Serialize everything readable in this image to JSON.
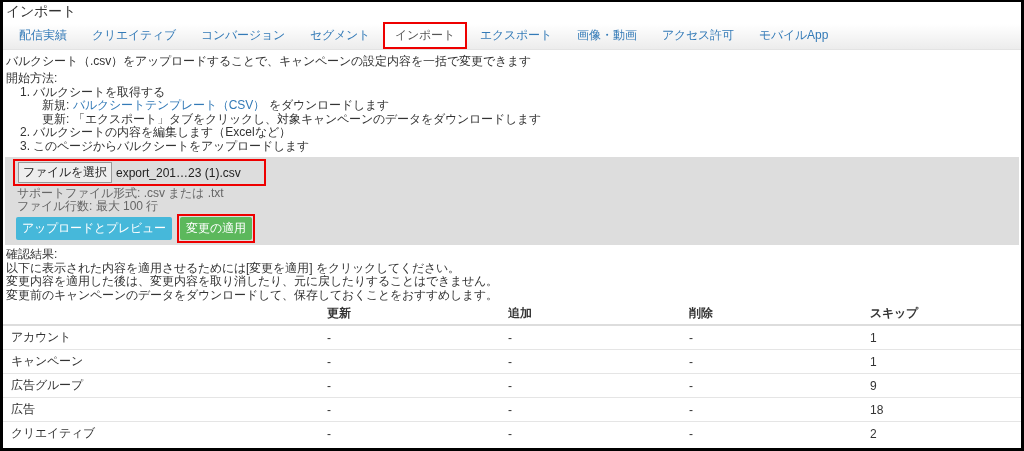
{
  "page_title": "インポート",
  "tabs": [
    {
      "label": "配信実績",
      "selected": false,
      "highlighted": false
    },
    {
      "label": "クリエイティブ",
      "selected": false,
      "highlighted": false
    },
    {
      "label": "コンバージョン",
      "selected": false,
      "highlighted": false
    },
    {
      "label": "セグメント",
      "selected": false,
      "highlighted": false
    },
    {
      "label": "インポート",
      "selected": true,
      "highlighted": true
    },
    {
      "label": "エクスポート",
      "selected": false,
      "highlighted": false
    },
    {
      "label": "画像・動画",
      "selected": false,
      "highlighted": false
    },
    {
      "label": "アクセス許可",
      "selected": false,
      "highlighted": false
    },
    {
      "label": "モバイルApp",
      "selected": false,
      "highlighted": false
    }
  ],
  "description": "バルクシート（.csv）をアップロードすることで、キャンペーンの設定内容を一括で変更できます",
  "instructions": {
    "heading": "開始方法:",
    "steps": [
      {
        "number": "1.",
        "text": "バルクシートを取得する",
        "children": [
          {
            "prefix": "新規: ",
            "link": "バルクシートテンプレート（CSV）",
            "suffix": " をダウンロードします"
          },
          {
            "prefix": "更新: 「エクスポート」タブをクリックし、対象キャンペーンのデータをダウンロードします"
          }
        ]
      },
      {
        "number": "2.",
        "text": "バルクシートの内容を編集します（Excelなど）"
      },
      {
        "number": "3.",
        "text": "このページからバルクシートをアップロードします"
      }
    ]
  },
  "upload": {
    "file_button": "ファイルを選択",
    "file_name": "export_201…23 (1).csv",
    "highlighted": true,
    "notes": [
      "サポートファイル形式: .csv または .txt",
      "ファイル行数: 最大 100 行"
    ],
    "buttons": [
      {
        "label": "アップロードとプレビュー",
        "kind": "info",
        "highlighted": false
      },
      {
        "label": "変更の適用",
        "kind": "success",
        "highlighted": true
      }
    ]
  },
  "results": {
    "heading": "確認結果:",
    "lines": [
      "以下に表示された内容を適用させるためには[変更を適用] をクリックしてください。",
      "変更内容を適用した後は、変更内容を取り消したり、元に戻したりすることはできません。",
      "変更前のキャンペーンのデータをダウンロードして、保存しておくことをおすすめします。"
    ]
  },
  "table": {
    "columns": [
      "",
      "更新",
      "追加",
      "削除",
      "スキップ"
    ],
    "rows": [
      [
        "アカウント",
        "-",
        "-",
        "-",
        "1"
      ],
      [
        "キャンペーン",
        "-",
        "-",
        "-",
        "1"
      ],
      [
        "広告グループ",
        "-",
        "-",
        "-",
        "9"
      ],
      [
        "広告",
        "-",
        "-",
        "-",
        "18"
      ],
      [
        "クリエイティブ",
        "-",
        "-",
        "-",
        "2"
      ]
    ]
  }
}
